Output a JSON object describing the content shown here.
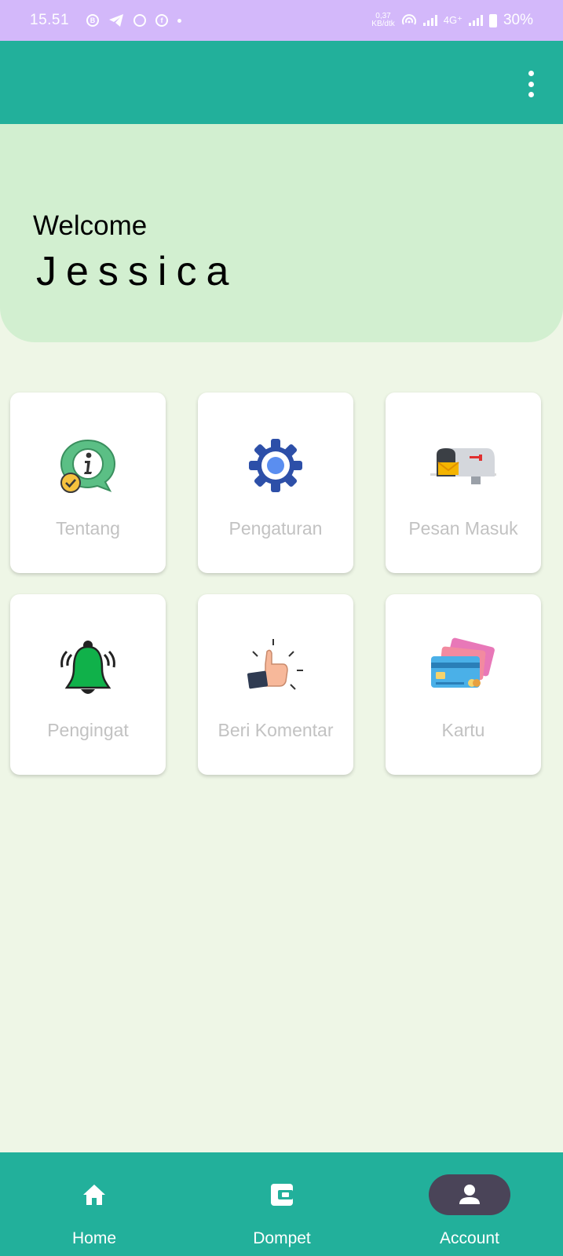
{
  "status_bar": {
    "time": "15.51",
    "speed_value": "0,37",
    "speed_unit": "KB/dtk",
    "network": "4G⁺",
    "battery": "30%"
  },
  "app_bar": {
    "menu_icon": "more-vert-icon"
  },
  "welcome": {
    "greeting": "Welcome",
    "name": "Jessica"
  },
  "menu_cards": [
    {
      "label": "Tentang",
      "icon": "info-bubble-icon"
    },
    {
      "label": "Pengaturan",
      "icon": "gear-icon"
    },
    {
      "label": "Pesan Masuk",
      "icon": "mailbox-icon"
    },
    {
      "label": "Pengingat",
      "icon": "bell-ringing-icon"
    },
    {
      "label": "Beri Komentar",
      "icon": "thumbs-up-icon"
    },
    {
      "label": "Kartu",
      "icon": "credit-card-icon"
    }
  ],
  "bottom_nav": {
    "items": [
      {
        "label": "Home",
        "icon": "home-icon",
        "active": false
      },
      {
        "label": "Dompet",
        "icon": "wallet-icon",
        "active": false
      },
      {
        "label": "Account",
        "icon": "person-icon",
        "active": true
      }
    ]
  },
  "colors": {
    "status_bar": "#d3b8fa",
    "primary": "#22b09b",
    "welcome_bg": "#d2efd0",
    "page_bg": "#eef6e6",
    "nav_active": "#4a4458",
    "card_label": "#c2c2c2"
  }
}
